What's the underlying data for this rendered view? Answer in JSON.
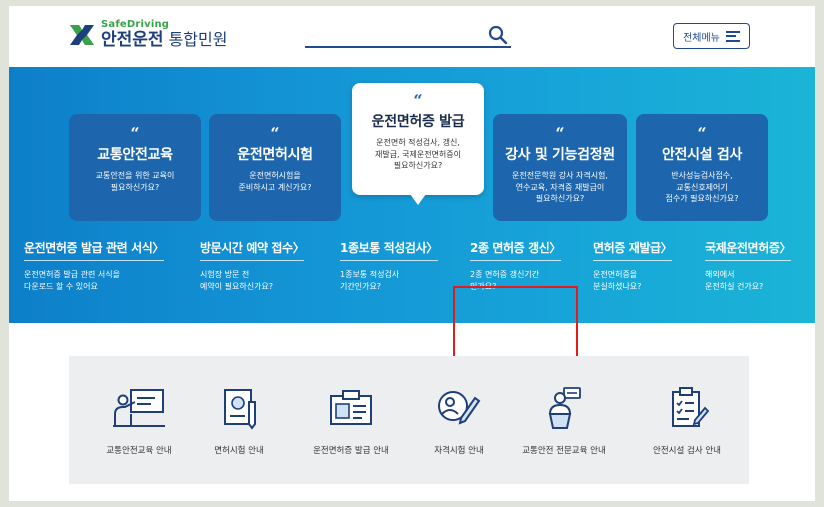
{
  "header": {
    "logo_top": "SafeDriving",
    "logo_main": "안전운전",
    "logo_sub": "통합민원",
    "search_placeholder": "",
    "menu_label": "전체메뉴"
  },
  "hero": {
    "quote_mark": "“",
    "cards": [
      {
        "title": "교통안전교육",
        "desc_lines": [
          "교통안전을 위한 교육이",
          "필요하신가요?"
        ]
      },
      {
        "title": "운전면허시험",
        "desc_lines": [
          "운전면허시험을",
          "준비하시고 계신가요?"
        ]
      },
      {
        "title": "운전면허증 발급",
        "desc_lines": [
          "운전면허 적성검사, 갱신,",
          "재발급, 국제운전면허증이",
          "필요하신가요?"
        ]
      },
      {
        "title": "강사 및 기능검정원",
        "desc_lines": [
          "운전전문학원 강사 자격시험,",
          "연수교육, 자격증 재발급이",
          "필요하신가요?"
        ]
      },
      {
        "title": "안전시설 검사",
        "desc_lines": [
          "반사성능검사접수,",
          "교통신호제어기",
          "접수가 필요하신가요?"
        ]
      }
    ],
    "links": [
      {
        "title": "운전면허증 발급 관련 서식",
        "desc_lines": [
          "운전면허증 발급 관련 서식을",
          "다운로드 할 수 있어요"
        ]
      },
      {
        "title": "방문시간 예약 접수",
        "desc_lines": [
          "시험장 방문 전",
          "예약이 필요하신가요?"
        ]
      },
      {
        "title": "1종보통 적성검사",
        "desc_lines": [
          "1종보통 적성검사",
          "기간인가요?"
        ]
      },
      {
        "title": "2종 면허증 갱신",
        "desc_lines": [
          "2종 면허증 갱신기간",
          "인가요?"
        ]
      },
      {
        "title": "면허증 재발급",
        "desc_lines": [
          "운전면허증을",
          "분실하셨나요?"
        ]
      },
      {
        "title": "국제운전면허증",
        "desc_lines": [
          "해외에서",
          "운전하실 건가요?"
        ]
      }
    ],
    "arrow": "〉"
  },
  "services": [
    {
      "label": "교통안전교육 안내",
      "icon": "presentation-icon"
    },
    {
      "label": "면허시험 안내",
      "icon": "exam-document-icon"
    },
    {
      "label": "운전면허증 발급 안내",
      "icon": "id-card-icon"
    },
    {
      "label": "자격시험 안내",
      "icon": "qualification-test-icon"
    },
    {
      "label": "교통안전 전문교육 안내",
      "icon": "lecture-podium-icon"
    },
    {
      "label": "안전시설 검사 안내",
      "icon": "checklist-icon"
    }
  ],
  "colors": {
    "brand_navy": "#1f3f7a",
    "brand_green": "#3aa24a",
    "card_blue": "#1d66ad",
    "highlight_red": "#e31b1b"
  }
}
